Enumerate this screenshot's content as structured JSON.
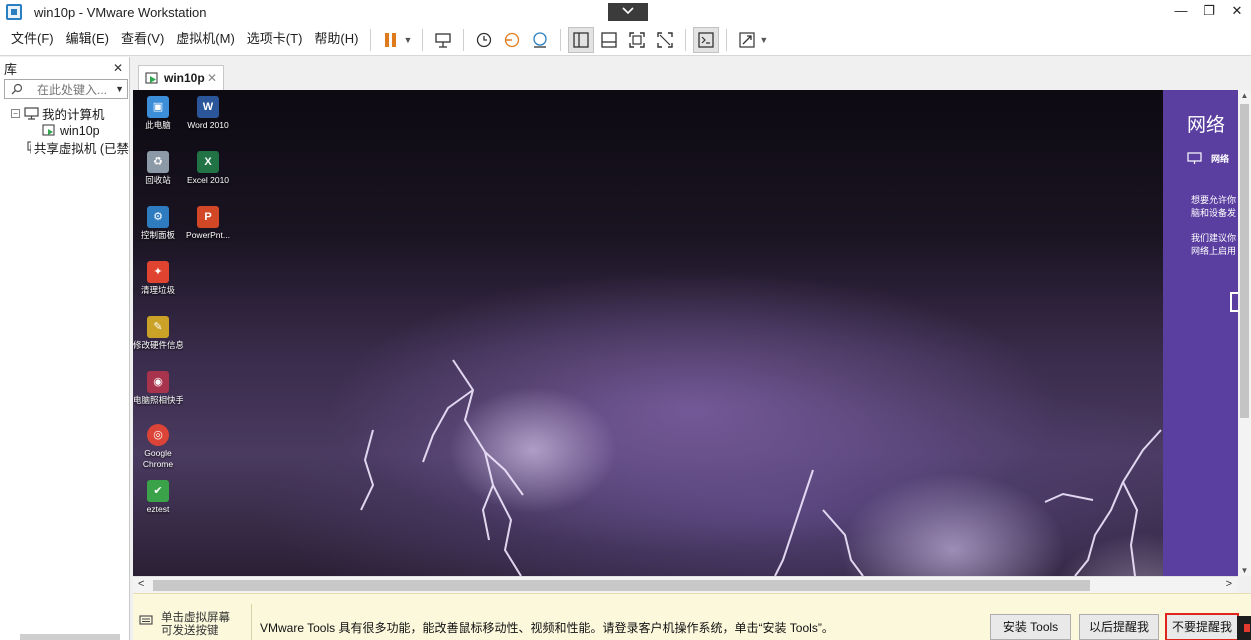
{
  "window": {
    "title": "win10p - VMware Workstation",
    "dropdown_icon": "chevron-down-icon",
    "controls": {
      "minimize": "—",
      "restore": "❐",
      "close": "✕"
    }
  },
  "menu": {
    "items": [
      "文件(F)",
      "编辑(E)",
      "查看(V)",
      "虚拟机(M)",
      "选项卡(T)",
      "帮助(H)"
    ]
  },
  "toolbar": {
    "icons": [
      "pause-icon",
      "send-ctrl-alt-del-icon",
      "snapshot-icon",
      "revert-snapshot-icon",
      "snapshot-manager-icon",
      "show-library-icon",
      "thumbnail-bar-icon",
      "full-screen-icon",
      "unity-icon",
      "console-view-icon",
      "stretch-guest-icon"
    ]
  },
  "library": {
    "title": "库",
    "close": "✕",
    "search_placeholder": "在此处键入...",
    "tree": {
      "my_computer": "我的计算机",
      "vm": "win10p",
      "shared": "共享虚拟机 (已禁"
    }
  },
  "tab": {
    "label": "win10p",
    "close": "✕"
  },
  "desktop": {
    "icons": [
      {
        "label": "此电脑",
        "color": "#3d8ed8",
        "glyph": "▣"
      },
      {
        "label": "Word 2010",
        "color": "#2b579a",
        "glyph": "W"
      },
      {
        "label": "回收站",
        "color": "#8c9aa8",
        "glyph": "♻"
      },
      {
        "label": "Excel 2010",
        "color": "#217346",
        "glyph": "X"
      },
      {
        "label": "控制面板",
        "color": "#2f7bc0",
        "glyph": "⚙"
      },
      {
        "label": "PowerPnt...",
        "color": "#d24726",
        "glyph": "P"
      },
      {
        "label": "清理垃圾",
        "color": "#e0432f",
        "glyph": "✦"
      },
      {
        "label": "修改硬件信息",
        "color": "#c9a227",
        "glyph": "✎"
      },
      {
        "label": "电脑照相快手",
        "color": "#a8334c",
        "glyph": "◉"
      },
      {
        "label": "Google Chrome",
        "color": "#db4437",
        "glyph": "◎"
      },
      {
        "label": "eztest",
        "color": "#3aa34a",
        "glyph": "✔"
      }
    ]
  },
  "network_panel": {
    "title": "网络",
    "item": "网络",
    "text1_line1": "想要允许你",
    "text1_line2": "脑和设备发",
    "text2_line1": "我们建议你",
    "text2_line2": "网络上启用",
    "bg_color": "#5a3fa0"
  },
  "bottom_bar": {
    "hint_line1": "单击虚拟屏幕",
    "hint_line2": "可发送按键",
    "message": "VMware Tools 具有很多功能，能改善鼠标移动性、视频和性能。请登录客户机操作系统，单击“安装 Tools”。",
    "install_button": "安装 Tools",
    "remind_button": "以后提醒我",
    "never_button": "不要提醒我",
    "highlight_color": "#e0261b"
  }
}
